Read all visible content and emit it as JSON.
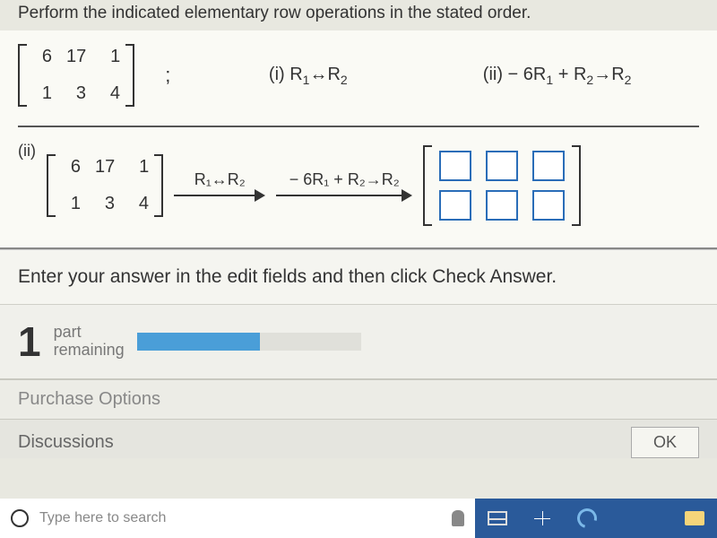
{
  "instruction_top": "Perform the indicated elementary row operations in the stated order.",
  "matrix_initial": {
    "r1": [
      "6",
      "17",
      "1"
    ],
    "r2": [
      "1",
      "3",
      "4"
    ]
  },
  "ops": {
    "i_label": "(i) R",
    "i_sub1": "1",
    "i_arrow": "↔",
    "i_sub2": "2",
    "ii_label": "(ii) − 6R",
    "ii_sub1": "1",
    "ii_plus": " + R",
    "ii_sub2": "2",
    "ii_arrow": "→R",
    "ii_sub3": "2"
  },
  "part2_label": "(ii)",
  "arrow_op1": "R₁↔R₂",
  "arrow_op2": "− 6R₁ + R₂→R₂",
  "enter_instruction": "Enter your answer in the edit fields and then click Check Answer.",
  "progress": {
    "num": "1",
    "line1": "part",
    "line2": "remaining",
    "percent": 55
  },
  "sections": {
    "purchase": "Purchase Options",
    "discussions": "Discussions"
  },
  "ok_btn": "OK",
  "search_placeholder": "Type here to search"
}
